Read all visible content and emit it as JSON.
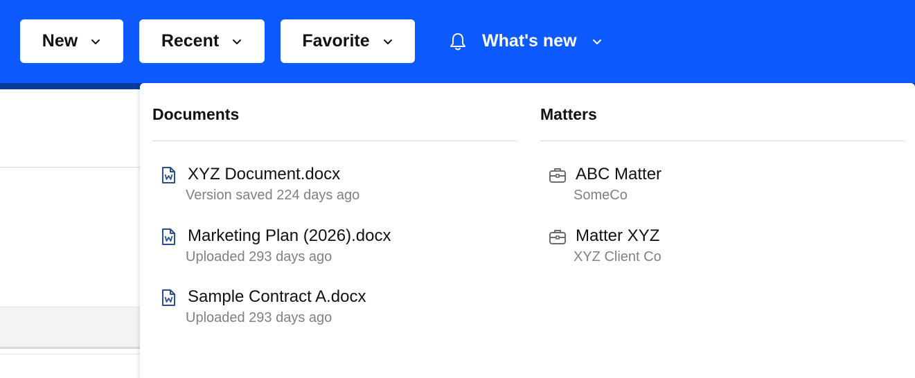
{
  "header": {
    "new_label": "New",
    "recent_label": "Recent",
    "favorite_label": "Favorite",
    "whats_new_label": "What's new"
  },
  "dropdown": {
    "documents": {
      "title": "Documents",
      "items": [
        {
          "name": "XYZ Document.docx",
          "sub": "Version saved 224 days ago"
        },
        {
          "name": "Marketing Plan (2026).docx",
          "sub": "Uploaded 293 days ago"
        },
        {
          "name": "Sample Contract A.docx",
          "sub": "Uploaded 293 days ago"
        }
      ]
    },
    "matters": {
      "title": "Matters",
      "items": [
        {
          "name": "ABC Matter",
          "sub": "SomeCo"
        },
        {
          "name": "Matter XYZ",
          "sub": "XYZ Client Co"
        }
      ]
    }
  },
  "colors": {
    "brand_blue": "#0d5bff",
    "doc_icon": "#2b4f8c",
    "matter_icon": "#6b6b6b"
  },
  "icons": {
    "doc": "word-document-icon",
    "matter": "briefcase-icon",
    "notification": "bell-icon",
    "dropdown": "chevron-down-icon"
  }
}
